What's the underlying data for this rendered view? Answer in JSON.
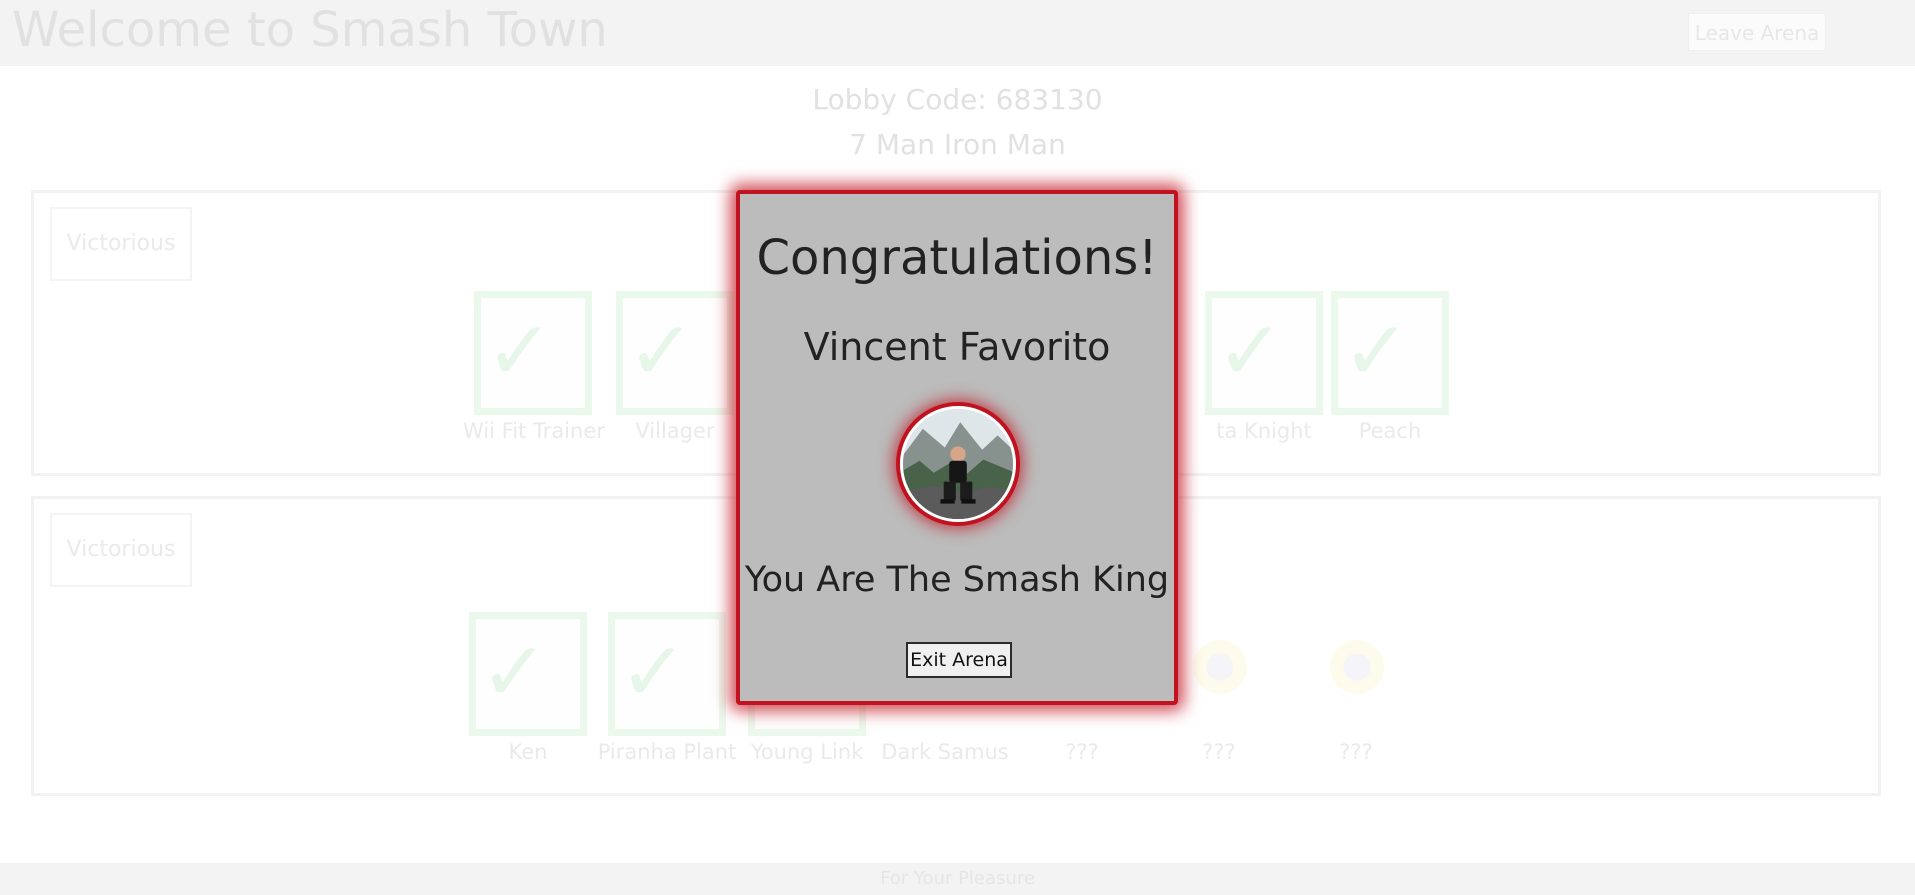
{
  "header": {
    "title": "Welcome to Smash Town",
    "leave_label": "Leave Arena"
  },
  "lobby": {
    "code": "Lobby Code: 683130",
    "mode": "7 Man Iron Man"
  },
  "teams": [
    {
      "badge": "Victorious",
      "fighters": [
        "Wii Fit Trainer",
        "Villager",
        "ta Knight",
        "Peach"
      ]
    },
    {
      "badge": "Victorious",
      "fighters": [
        "Ken",
        "Piranha Plant",
        "Young Link",
        "Dark Samus",
        "???",
        "???",
        "???"
      ]
    }
  ],
  "footer": {
    "text": "For Your Pleasure"
  },
  "modal": {
    "title": "Congratulations!",
    "winner": "Vincent Favorito",
    "tagline": "You Are The Smash King",
    "exit_label": "Exit Arena"
  },
  "colors": {
    "modal_background": "#bcbcbc",
    "modal_glow": "#c1121f",
    "check_green": "#e2f5e5"
  }
}
